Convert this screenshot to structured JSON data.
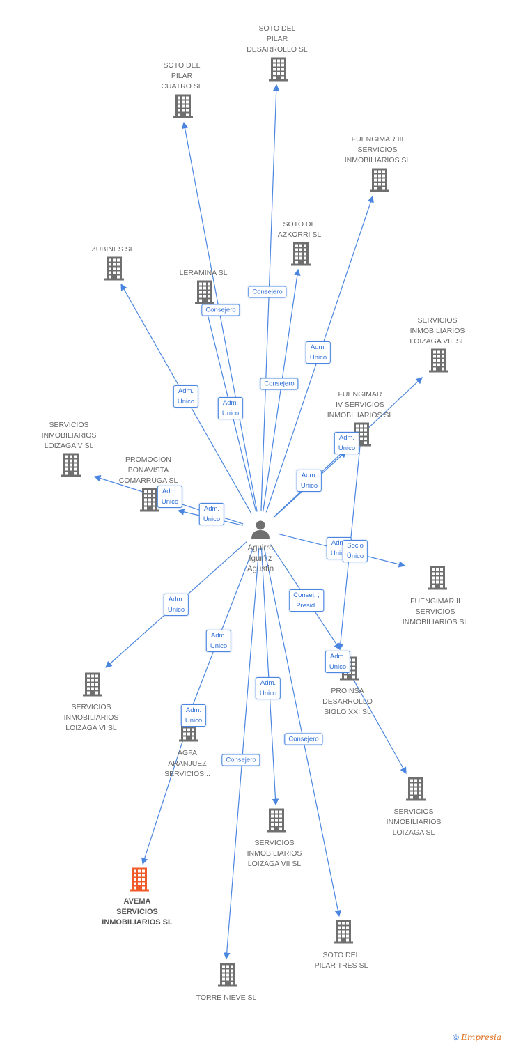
{
  "center": {
    "label": "Aguirre\nIguiñiz\nAgustin",
    "icon": "person-icon"
  },
  "colors": {
    "edge": "#4a86e0",
    "building": "#6f6f6f",
    "highlight": "#f05a28"
  },
  "nodes": [
    {
      "id": "soto_desarrollo",
      "label": "SOTO DEL\nPILAR\nDESARROLLO SL"
    },
    {
      "id": "soto_cuatro",
      "label": "SOTO DEL\nPILAR\nCUATRO SL"
    },
    {
      "id": "fuengimar3",
      "label": "FUENGIMAR III\nSERVICIOS\nINMOBILIARIOS SL"
    },
    {
      "id": "azkorri",
      "label": "SOTO DE\nAZKORRI SL"
    },
    {
      "id": "zubines",
      "label": "ZUBINES SL"
    },
    {
      "id": "leramina",
      "label": "LERAMINA SL"
    },
    {
      "id": "loizaga8",
      "label": "SERVICIOS\nINMOBILIARIOS\nLOIZAGA VIII SL"
    },
    {
      "id": "fuengimar4",
      "label": "FUENGIMAR\nIV SERVICIOS\nINMOBILIARIOS SL"
    },
    {
      "id": "loizaga5",
      "label": "SERVICIOS\nINMOBILIARIOS\nLOIZAGA V SL"
    },
    {
      "id": "promocion",
      "label": "PROMOCION\nBONAVISTA\nCOMARRUGA SL"
    },
    {
      "id": "fuengimar2",
      "label": "FUENGIMAR II\nSERVICIOS\nINMOBILIARIOS SL"
    },
    {
      "id": "loizaga6",
      "label": "SERVICIOS\nINMOBILIARIOS\nLOIZAGA VI SL"
    },
    {
      "id": "proinsa",
      "label": "PROINSA\nDESARROLLO\nSIGLO XXI SL"
    },
    {
      "id": "agfa",
      "label": "AGFA\nARANJUEZ\nSERVICIOS..."
    },
    {
      "id": "loizaga",
      "label": "SERVICIOS\nINMOBILIARIOS\nLOIZAGA SL"
    },
    {
      "id": "loizaga7",
      "label": "SERVICIOS\nINMOBILIARIOS\nLOIZAGA VII SL"
    },
    {
      "id": "avema",
      "label": "AVEMA\nSERVICIOS\nINMOBILIARIOS SL",
      "highlight": true
    },
    {
      "id": "tres",
      "label": "SOTO DEL\nPILAR TRES SL"
    },
    {
      "id": "torre",
      "label": "TORRE NIEVE SL"
    }
  ],
  "edges": [
    {
      "from": "center",
      "to": "soto_desarrollo",
      "label": "Consejero"
    },
    {
      "from": "center",
      "to": "soto_cuatro",
      "label": "Consejero"
    },
    {
      "from": "center",
      "to": "fuengimar3",
      "label": "Adm.\nUnico"
    },
    {
      "from": "center",
      "to": "azkorri",
      "label": "Consejero"
    },
    {
      "from": "center",
      "to": "zubines",
      "label": "Adm.\nUnico"
    },
    {
      "from": "center",
      "to": "leramina",
      "label": "Adm.\nUnico"
    },
    {
      "from": "center",
      "to": "loizaga8",
      "label": "Adm.\nUnico"
    },
    {
      "from": "center",
      "to": "fuengimar4",
      "label": "Adm.\nUnico"
    },
    {
      "from": "center",
      "to": "loizaga5",
      "label": "Adm.\nUnico"
    },
    {
      "from": "center",
      "to": "promocion",
      "label": "Adm.\nUnico"
    },
    {
      "from": "center",
      "to": "fuengimar2",
      "label": "Adm.\nUnico"
    },
    {
      "from": "fuengimar4",
      "to": "proinsa",
      "label": "Socio\nÚnico"
    },
    {
      "from": "center",
      "to": "proinsa",
      "label": "Consej. ,\nPresid."
    },
    {
      "from": "proinsa",
      "to": "loizaga",
      "label": "Adm.\nUnico"
    },
    {
      "from": "center",
      "to": "loizaga6",
      "label": "Adm.\nUnico"
    },
    {
      "from": "center",
      "to": "agfa",
      "label": "Adm.\nUnico"
    },
    {
      "from": "agfa",
      "to": "avema",
      "label": "Adm.\nUnico"
    },
    {
      "from": "center",
      "to": "loizaga7",
      "label": "Adm.\nUnico"
    },
    {
      "from": "center",
      "to": "tres",
      "label": "Consejero"
    },
    {
      "from": "center",
      "to": "torre",
      "label": "Consejero"
    }
  ],
  "footer": {
    "copyright": "©",
    "brand": "Empresia"
  }
}
